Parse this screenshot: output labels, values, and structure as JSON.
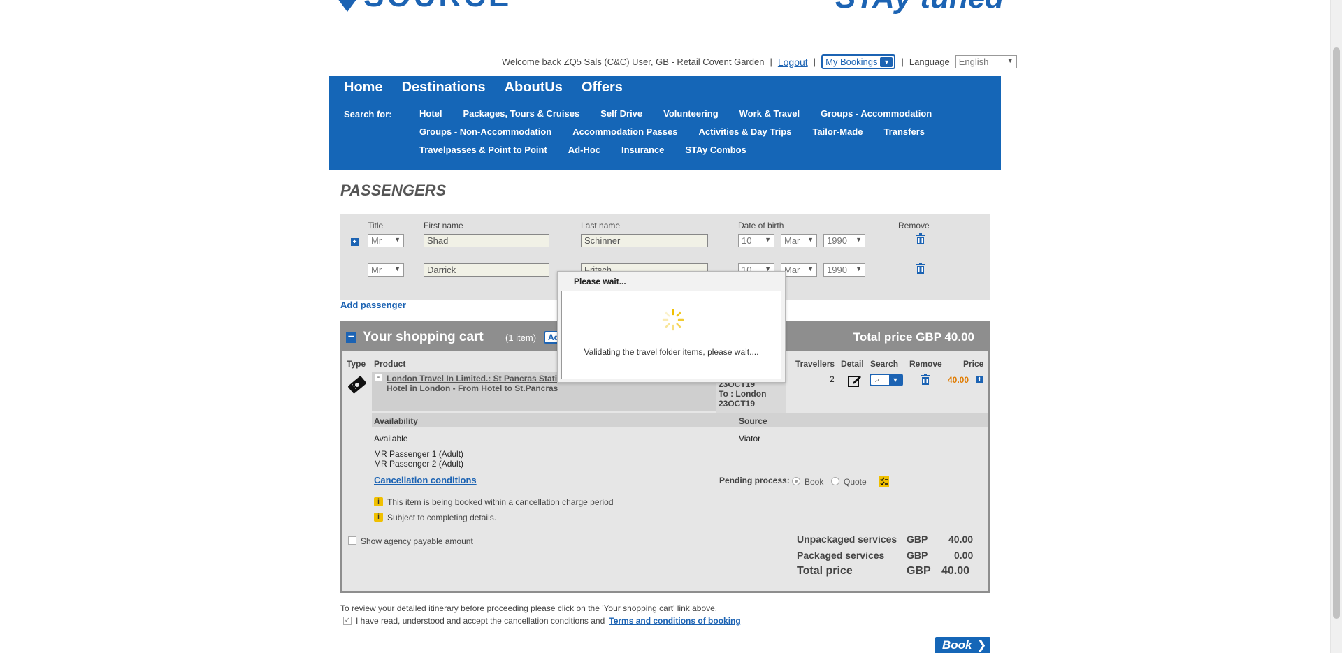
{
  "header": {
    "logo_text": "SOURCE",
    "tagline": "STAy tuned"
  },
  "userbar": {
    "welcome": "Welcome back ZQ5 Sals (C&C) User, GB - Retail Covent Garden",
    "logout": "Logout",
    "my_bookings": "My Bookings",
    "language_label": "Language",
    "language_value": "English"
  },
  "nav": {
    "main": [
      "Home",
      "Destinations",
      "AboutUs",
      "Offers"
    ],
    "search_for": "Search for:",
    "links_row1": [
      "Hotel",
      "Packages, Tours & Cruises",
      "Self Drive",
      "Volunteering",
      "Work & Travel",
      "Groups - Accommodation"
    ],
    "links_row2": [
      "Groups - Non-Accommodation",
      "Accommodation Passes",
      "Activities & Day Trips",
      "Tailor-Made",
      "Transfers"
    ],
    "links_row3": [
      "Travelpasses & Point to Point",
      "Ad-Hoc",
      "Insurance",
      "STAy Combos"
    ]
  },
  "passengers": {
    "title": "PASSENGERS",
    "labels": {
      "title": "Title",
      "first": "First name",
      "last": "Last name",
      "dob": "Date of birth",
      "remove": "Remove"
    },
    "rows": [
      {
        "title": "Mr",
        "first": "Shad",
        "last": "Schinner",
        "day": "10",
        "month": "Mar",
        "year": "1990"
      },
      {
        "title": "Mr",
        "first": "Darrick",
        "last": "Fritsch",
        "day": "10",
        "month": "Mar",
        "year": "1990"
      }
    ],
    "add": "Add passenger"
  },
  "cart": {
    "title": "Your shopping cart",
    "count": "(1 item)",
    "add_btn": "Ad",
    "total": "Total price GBP 40.00",
    "columns": {
      "type": "Type",
      "product": "Product",
      "travellers": "Travellers",
      "detail": "Detail",
      "search": "Search",
      "remove": "Remove",
      "price": "Price"
    },
    "product_line1": "London Travel In Limited.: St Pancras Stati",
    "product_line2": "Hotel in London - From Hotel to St.Pancras",
    "dates": [
      "23OCT19",
      "To : London",
      "23OCT19"
    ],
    "travellers": "2",
    "price": "40.00",
    "availability_label": "Availability",
    "availability_value": "Available",
    "source_label": "Source",
    "source_value": "Viator",
    "pax1": "MR Passenger 1 (Adult)",
    "pax2": "MR Passenger 2 (Adult)",
    "cancel_link": "Cancellation conditions",
    "pending_label": "Pending process:",
    "book_opt": "Book",
    "quote_opt": "Quote",
    "info1": "This item is being booked within a cancellation charge period",
    "info2": "Subject to completing details.",
    "show_agency": "Show agency payable amount",
    "summary": [
      {
        "label": "Unpackaged services",
        "cur": "GBP",
        "val": "40.00"
      },
      {
        "label": "Packaged services",
        "cur": "GBP",
        "val": "0.00"
      },
      {
        "label": "Total price",
        "cur": "GBP",
        "val": "40.00"
      }
    ]
  },
  "footer": {
    "note": "To review your detailed itinerary before proceeding please click on the 'Your shopping cart' link above.",
    "terms_text": "I have read, understood and accept the cancellation conditions and",
    "terms_link": "Terms and conditions of booking",
    "book": "Book"
  },
  "modal": {
    "title": "Please wait...",
    "message": "Validating the travel folder items, please wait...."
  },
  "colors": {
    "brand_blue": "#1566b7",
    "cart_grey": "#8e8e8e",
    "price_orange": "#e07b00",
    "info_yellow": "#f0c000"
  }
}
